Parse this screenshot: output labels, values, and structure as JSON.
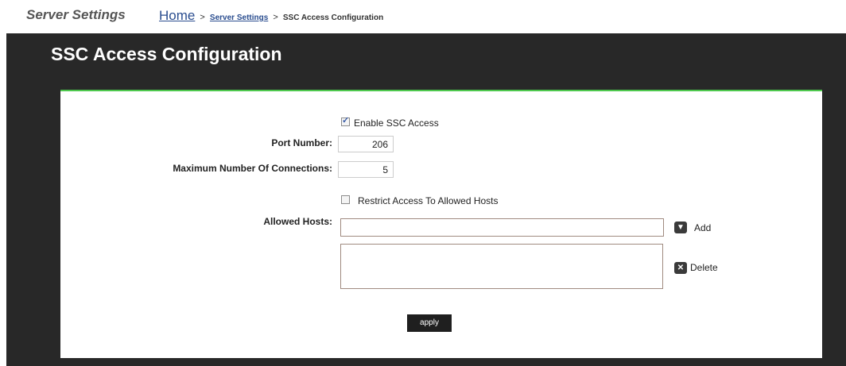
{
  "header": {
    "section_title": "Server Settings",
    "breadcrumb": {
      "home": "Home",
      "sep1": ">",
      "server_settings": "Server Settings",
      "sep2": ">",
      "current": "SSC Access Configuration"
    }
  },
  "page": {
    "title": "SSC Access Configuration"
  },
  "form": {
    "enable_ssc": {
      "label": "Enable SSC Access",
      "checked": true
    },
    "port_number": {
      "label": "Port Number:",
      "value": "206"
    },
    "max_connections": {
      "label": "Maximum Number Of Connections:",
      "value": "5"
    },
    "restrict_access": {
      "label": "Restrict Access To Allowed Hosts",
      "checked": false
    },
    "allowed_hosts": {
      "label": "Allowed Hosts:",
      "value": ""
    },
    "add_label": "Add",
    "delete_label": "Delete",
    "apply_label": "apply"
  },
  "colors": {
    "panel_top_border": "#4ec84e",
    "dark_background": "#282828",
    "link": "#2a4d8f"
  },
  "icons": {
    "add": "add-down-arrow-icon",
    "delete": "delete-x-icon"
  }
}
